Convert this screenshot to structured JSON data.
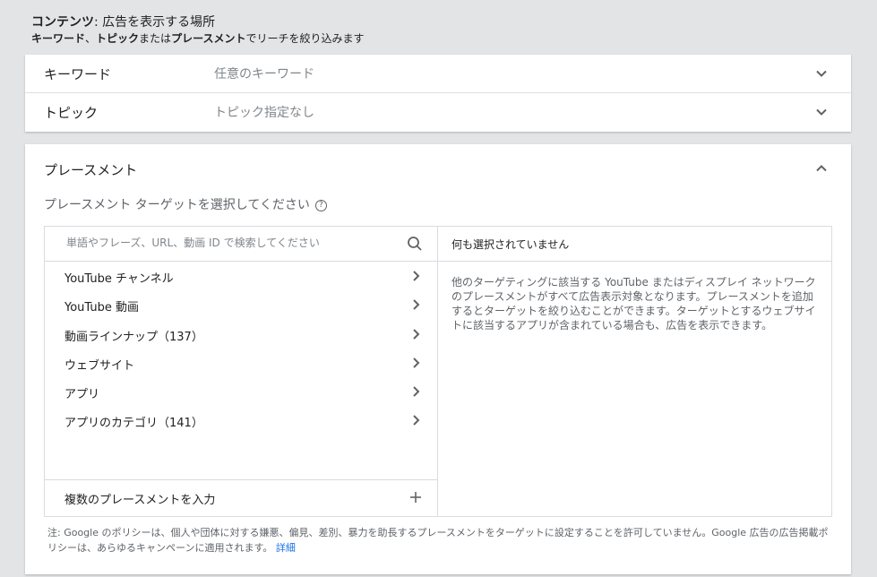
{
  "header": {
    "bold_prefix": "コンテンツ",
    "title_rest": ": 広告を表示する場所",
    "sub_kw": "キーワード",
    "sub_sep1": "、",
    "sub_topic": "トピック",
    "sub_sep2": "または",
    "sub_pl": "プレースメント",
    "sub_rest": "でリーチを絞り込みます"
  },
  "rows": [
    {
      "title": "キーワード",
      "value": "任意のキーワード"
    },
    {
      "title": "トピック",
      "value": "トピック指定なし"
    }
  ],
  "placement": {
    "title": "プレースメント",
    "subtitle": "プレースメント ターゲットを選択してください",
    "help_glyph": "?",
    "search_placeholder": "単語やフレーズ、URL、動画 ID で検索してください",
    "items": [
      "YouTube チャンネル",
      "YouTube 動画",
      "動画ラインナップ（137）",
      "ウェブサイト",
      "アプリ",
      "アプリのカテゴリ（141）"
    ],
    "multi_label": "複数のプレースメントを入力",
    "selected_header": "何も選択されていません",
    "selected_desc": "他のターゲティングに該当する YouTube またはディスプレイ ネットワークのプレースメントがすべて広告表示対象となります。プレースメントを追加するとターゲットを絞り込むことができます。ターゲットとするウェブサイトに該当するアプリが含まれている場合も、広告を表示できます。",
    "note": "注: Google のポリシーは、個人や団体に対する嫌悪、偏見、差別、暴力を助長するプレースメントをターゲットに設定することを許可していません。Google 広告の広告掲載ポリシーは、あらゆるキャンペーンに適用されます。",
    "note_link": "詳細"
  },
  "colors": {
    "link": "#1a73e8",
    "text": "#202124",
    "muted": "#5f6368",
    "background": "#e3e4e6"
  }
}
